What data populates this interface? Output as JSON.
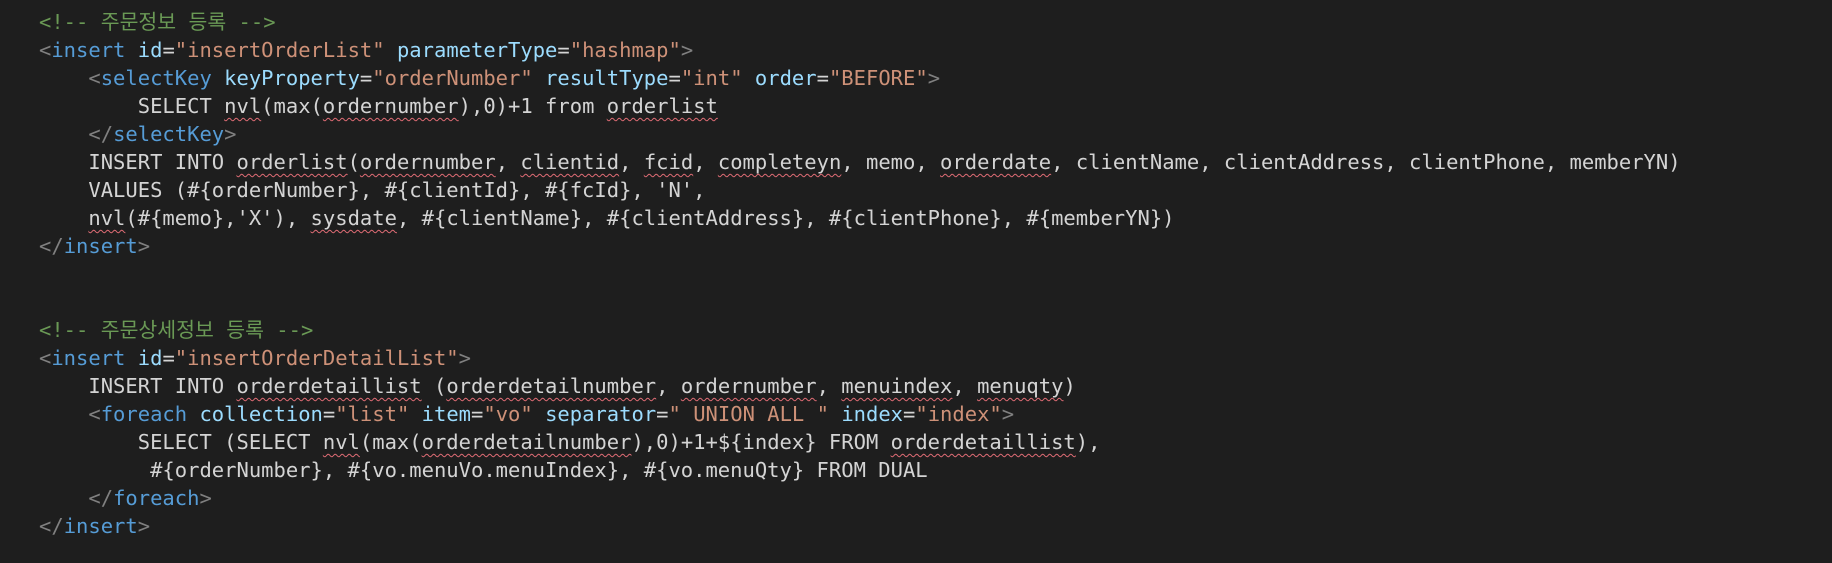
{
  "colors": {
    "background": "#1e1e1e",
    "text": "#d4d4d4",
    "comment": "#6a9955",
    "tag": "#569cd6",
    "attribute": "#9cdcfe",
    "string": "#ce9178",
    "spell_underline": "#e06c75"
  },
  "code_lines": [
    [
      [
        "comment",
        "<!-- 주문정보 등록 -->"
      ]
    ],
    [
      [
        "punct",
        "<"
      ],
      [
        "tag",
        "insert"
      ],
      [
        "txt",
        " "
      ],
      [
        "attr",
        "id"
      ],
      [
        "txt",
        "="
      ],
      [
        "str",
        "\"insertOrderList\""
      ],
      [
        "txt",
        " "
      ],
      [
        "attr",
        "parameterType"
      ],
      [
        "txt",
        "="
      ],
      [
        "str",
        "\"hashmap\""
      ],
      [
        "punct",
        ">"
      ]
    ],
    [
      [
        "txt",
        "    "
      ],
      [
        "punct",
        "<"
      ],
      [
        "tag",
        "selectKey"
      ],
      [
        "txt",
        " "
      ],
      [
        "attr",
        "keyProperty"
      ],
      [
        "txt",
        "="
      ],
      [
        "str",
        "\"orderNumber\""
      ],
      [
        "txt",
        " "
      ],
      [
        "attr",
        "resultType"
      ],
      [
        "txt",
        "="
      ],
      [
        "str",
        "\"int\""
      ],
      [
        "txt",
        " "
      ],
      [
        "attr",
        "order"
      ],
      [
        "txt",
        "="
      ],
      [
        "str",
        "\"BEFORE\""
      ],
      [
        "punct",
        ">"
      ]
    ],
    [
      [
        "txt",
        "        SELECT "
      ],
      [
        "warn",
        "nvl"
      ],
      [
        "txt",
        "(max("
      ],
      [
        "warn",
        "ordernumber"
      ],
      [
        "txt",
        "),0)+1 from "
      ],
      [
        "warn",
        "orderlist"
      ]
    ],
    [
      [
        "txt",
        "    "
      ],
      [
        "punct",
        "</"
      ],
      [
        "tag",
        "selectKey"
      ],
      [
        "punct",
        ">"
      ]
    ],
    [
      [
        "txt",
        "    INSERT INTO "
      ],
      [
        "warn",
        "orderlist"
      ],
      [
        "txt",
        "("
      ],
      [
        "warn",
        "ordernumber"
      ],
      [
        "txt",
        ", "
      ],
      [
        "warn",
        "clientid"
      ],
      [
        "txt",
        ", "
      ],
      [
        "warn",
        "fcid"
      ],
      [
        "txt",
        ", "
      ],
      [
        "warn",
        "completeyn"
      ],
      [
        "txt",
        ", memo, "
      ],
      [
        "warn",
        "orderdate"
      ],
      [
        "txt",
        ", clientName, clientAddress, clientPhone, memberYN)"
      ]
    ],
    [
      [
        "txt",
        "    VALUES (#{orderNumber}, #{clientId}, #{fcId}, 'N',"
      ]
    ],
    [
      [
        "txt",
        "    "
      ],
      [
        "warn",
        "nvl"
      ],
      [
        "txt",
        "(#{memo},'X'), "
      ],
      [
        "warn",
        "sysdate"
      ],
      [
        "txt",
        ", #{clientName}, #{clientAddress}, #{clientPhone}, #{memberYN})"
      ]
    ],
    [
      [
        "punct",
        "</"
      ],
      [
        "tag",
        "insert"
      ],
      [
        "punct",
        ">"
      ]
    ],
    [],
    [],
    [
      [
        "comment",
        "<!-- 주문상세정보 등록 -->"
      ]
    ],
    [
      [
        "punct",
        "<"
      ],
      [
        "tag",
        "insert"
      ],
      [
        "txt",
        " "
      ],
      [
        "attr",
        "id"
      ],
      [
        "txt",
        "="
      ],
      [
        "str",
        "\"insertOrderDetailList\""
      ],
      [
        "punct",
        ">"
      ]
    ],
    [
      [
        "txt",
        "    INSERT INTO "
      ],
      [
        "warn",
        "orderdetaillist"
      ],
      [
        "txt",
        " ("
      ],
      [
        "warn",
        "orderdetailnumber"
      ],
      [
        "txt",
        ", "
      ],
      [
        "warn",
        "ordernumber"
      ],
      [
        "txt",
        ", "
      ],
      [
        "warn",
        "menuindex"
      ],
      [
        "txt",
        ", "
      ],
      [
        "warn",
        "menuqty"
      ],
      [
        "txt",
        ")"
      ]
    ],
    [
      [
        "txt",
        "    "
      ],
      [
        "punct",
        "<"
      ],
      [
        "tag",
        "foreach"
      ],
      [
        "txt",
        " "
      ],
      [
        "attr",
        "collection"
      ],
      [
        "txt",
        "="
      ],
      [
        "str",
        "\"list\""
      ],
      [
        "txt",
        " "
      ],
      [
        "attr",
        "item"
      ],
      [
        "txt",
        "="
      ],
      [
        "str",
        "\"vo\""
      ],
      [
        "txt",
        " "
      ],
      [
        "attr",
        "separator"
      ],
      [
        "txt",
        "="
      ],
      [
        "str",
        "\" UNION ALL \""
      ],
      [
        "txt",
        " "
      ],
      [
        "attr",
        "index"
      ],
      [
        "txt",
        "="
      ],
      [
        "str",
        "\"index\""
      ],
      [
        "punct",
        ">"
      ]
    ],
    [
      [
        "txt",
        "        SELECT (SELECT "
      ],
      [
        "warn",
        "nvl"
      ],
      [
        "txt",
        "(max("
      ],
      [
        "warn",
        "orderdetailnumber"
      ],
      [
        "txt",
        "),0)+1+${index} FROM "
      ],
      [
        "warn",
        "orderdetaillist"
      ],
      [
        "txt",
        "),"
      ]
    ],
    [
      [
        "txt",
        "         #{orderNumber}, #{vo.menuVo.menuIndex}, #{vo.menuQty} FROM DUAL"
      ]
    ],
    [
      [
        "txt",
        "    "
      ],
      [
        "punct",
        "</"
      ],
      [
        "tag",
        "foreach"
      ],
      [
        "punct",
        ">"
      ]
    ],
    [
      [
        "punct",
        "</"
      ],
      [
        "tag",
        "insert"
      ],
      [
        "punct",
        ">"
      ]
    ]
  ]
}
